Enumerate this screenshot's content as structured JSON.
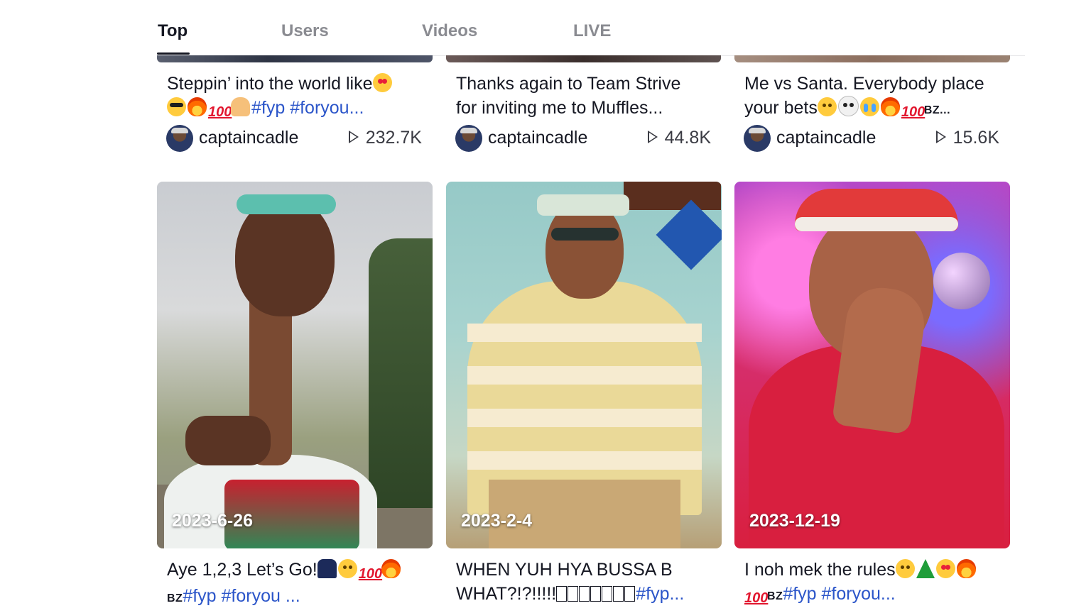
{
  "tabs": [
    {
      "label": "Top",
      "active": true
    },
    {
      "label": "Users",
      "active": false
    },
    {
      "label": "Videos",
      "active": false
    },
    {
      "label": "LIVE",
      "active": false
    }
  ],
  "top_row": [
    {
      "caption_line1": "Steppin’ into the world like",
      "hashtags": "#fyp #foryou...",
      "author": "captaincadle",
      "plays": "232.7K"
    },
    {
      "caption_line1": "Thanks again to Team Strive",
      "caption_line2": "for inviting me to Muffles...",
      "author": "captaincadle",
      "plays": "44.8K"
    },
    {
      "caption_line1": "Me vs Santa. Everybody place",
      "caption_line2_text": "your bets",
      "bz": "BZ...",
      "author": "captaincadle",
      "plays": "15.6K"
    }
  ],
  "bottom_row": [
    {
      "date": "2023-6-26",
      "caption_line1": "Aye 1,2,3 Let’s Go!",
      "bz": "BZ",
      "hashtags": "#fyp #foryou ...",
      "accent": "#c9ccd1"
    },
    {
      "date": "2023-2-4",
      "caption_line1": "WHEN YUH HYA BUSSA B",
      "caption_line2_text": "WHAT?!?!!!!!",
      "hashtags": "#fyp...",
      "accent": "#a7d3cf"
    },
    {
      "date": "2023-12-19",
      "caption_line1": "I noh mek the rules",
      "bz": "BZ",
      "hashtags": "#fyp #foryou...",
      "accent": "#d81f3f"
    }
  ],
  "colors": {
    "text": "#161823",
    "muted": "#8a8b91",
    "hashtag": "#2b55c9",
    "divider": "#e6e6e8"
  }
}
